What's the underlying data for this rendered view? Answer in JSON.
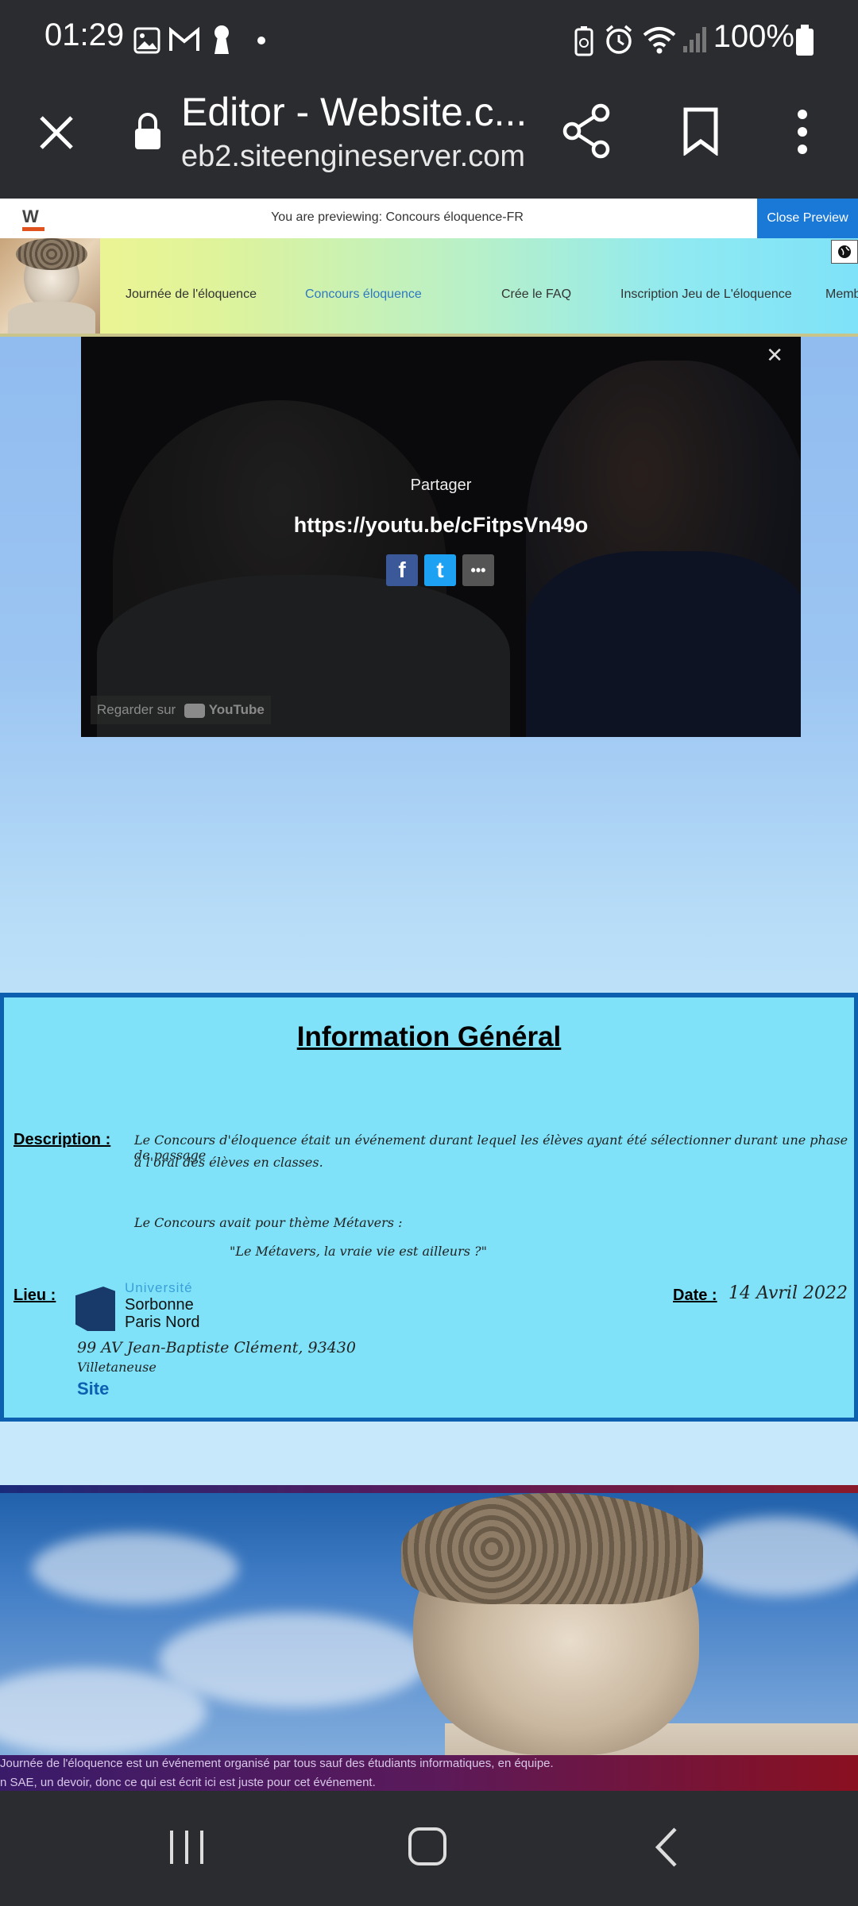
{
  "status_bar": {
    "time": "01:29",
    "battery": "100%"
  },
  "browser": {
    "tab_title": "Editor - Website.c...",
    "url": "eb2.siteengineserver.com"
  },
  "preview": {
    "message": "You are previewing: Concours éloquence-FR",
    "close_label": "Close Preview",
    "logo_letter": "W"
  },
  "nav": {
    "items": [
      {
        "label": "Journée de l'éloquence"
      },
      {
        "label": "Concours éloquence"
      },
      {
        "label": "Crée le FAQ"
      },
      {
        "label": "Inscription Jeu de L'éloquence"
      },
      {
        "label": "Memb"
      }
    ],
    "active_index": 1
  },
  "video": {
    "share_title": "Partager",
    "link": "https://youtu.be/cFitpsVn49o",
    "watch_on": "Regarder sur",
    "youtube": "YouTube",
    "share_buttons": [
      {
        "label": "f",
        "color": "#3b5998"
      },
      {
        "label": "t",
        "color": "#1da1f2"
      },
      {
        "label": "•••",
        "color": "#555555"
      }
    ]
  },
  "info": {
    "title": "Information Général",
    "description_label": "Description :",
    "description_line1": "Le Concours d'éloquence était un événement durant lequel les élèves ayant été sélectionner durant une phase de passage",
    "description_line2": "à l'oral des élèves en classes.",
    "theme_line": "Le Concours avait pour thème Métavers :",
    "quote": "\"Le Métavers, la vraie vie est ailleurs ?\"",
    "lieu_label": "Lieu :",
    "university_line1": "Université",
    "university_line2": "Sorbonne",
    "university_line3": "Paris Nord",
    "address_line1": "99 AV Jean-Baptiste Clément, 93430",
    "address_line2": "Villetaneuse",
    "site_link": "Site",
    "date_label": "Date :",
    "date_value": "14 Avril 2022"
  },
  "footer": {
    "line1": "Journée de l'éloquence est un événement organisé par tous sauf des étudiants informatiques, en équipe.",
    "line2": "n SAE, un devoir, donc ce qui est écrit ici est juste pour cet événement."
  },
  "colors": {
    "accent": "#1a78d6",
    "info_bg": "#7fe2f8",
    "info_border": "#0d5fb0",
    "chrome_bg": "#2b2c30"
  }
}
